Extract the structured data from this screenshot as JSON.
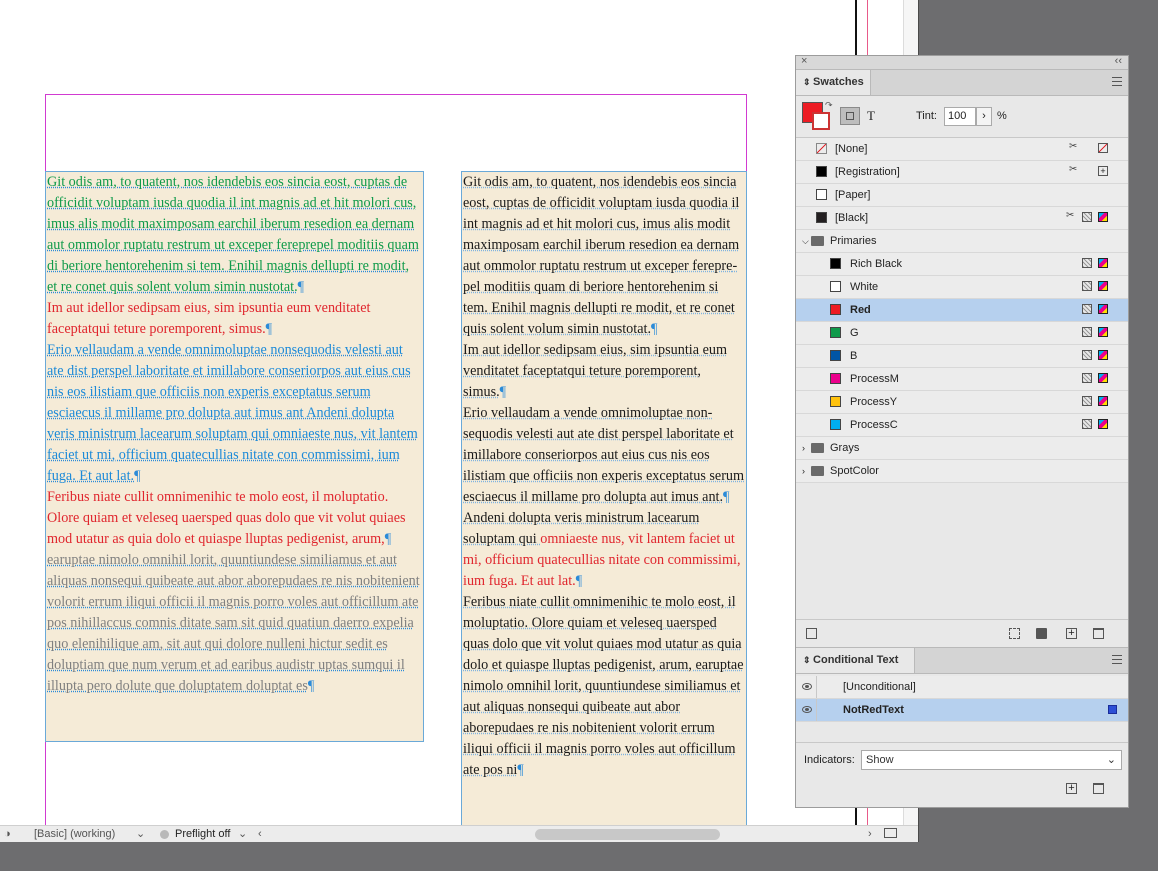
{
  "document": {
    "frame1": [
      {
        "cls": "green",
        "text": "Git odis am, to quatent, nos idendebis eos sincia eost, cup­tas de officidit voluptam iusda quodia il int magnis ad et hit molori cus, imus alis modit maximposam earchil ibe­rum resedion ea dernam aut ommolor ruptatu restrum ut exceper ferepre­pel moditiis quam di beriore hentorehen­im si tem. Enihil magnis dellupti re modit, et re conet quis solent volum simin nustotat."
      },
      {
        "cls": "red",
        "text": "Im aut idellor sedipsam eius, sim ipsuntia eum venditatet faceptatqui teture poremporent, simus."
      },
      {
        "cls": "blue",
        "text": "Erio vellaudam a vende omnimoluptae nonsequodis velesti aut ate dist perspel laboritate et imillabore conseriorpos aut eius cus nis eos ilistiam que officiis non experis excep­tatus serum esciaecus il millame pro dolupta aut imus ant Andeni dolupta veris ministrum lacearum soluptam qui omnia­este nus, vit lantem faciet ut mi, officium quatecul­lias nitate con commissimi, ium fuga. Et aut lat."
      },
      {
        "cls": "red",
        "text": "Feribus niate cullit omnimenihic te molo eost, il molupta­tio. Olore quiam et veleseq uaersped quas dolo que vit volut quiaes mod utatur as quia dolo et quiaspe llupta­s pedigenist, arum,"
      },
      {
        "cls": "gray",
        "text": " earuptae nimolo omnihil lorit, quunti­undese similiamus et aut aliquas nonsequi quibeate aut abor aborepudaes re nis nobitenient volorit errum iliqui officii il magnis porro voles aut officillum ate pos nihil­laccus comnis ditate sam sit quid quatiun daerro expelia quo elenihilique am, sit aut qui dolore nulleni hictur sedit es doluptiam que num verum et ad earibus audistr uptas sumqui il illupta pero dolute que doluptatem doluptat es"
      }
    ],
    "frame2": [
      {
        "cls": "black",
        "text": "Git odis am, to quatent, nos idendebis eos sincia eost, cuptas de officidit voluptam ius­da quodia il int magnis ad et hit molori cus, imus alis modit maximposam earchil iberum resedion ea dernam aut ommolor ruptatu re­strum ut exceper ferepre­pel moditiis quam di beriore hentorehenim si tem. Enihil mag­nis dellupti re modit, et re conet quis solent volum simin nustotat."
      },
      {
        "cls": "black",
        "text": "Im aut idellor sedipsam eius, sim ipsuntia eum venditatet faceptatqui teture porem­porent, simus."
      },
      {
        "cls": "black",
        "text": "Erio vellaudam a vende omnimoluptae non­sequodis velesti aut ate dist perspel labor­itate et imillabore conseriorpos aut eius cus nis eos ilistiam que officiis non experis exceptatus serum esciaecus il millame pro dolupta aut imus ant."
      },
      {
        "cls": "black",
        "text": "Andeni dolupta veris ministrum lacearum soluptam qui ",
        "red": "omniaeste nus, vit lantem fa­ciet ut mi, officium quatecullias nitate con commissimi, ium fuga. Et aut lat."
      },
      {
        "cls": "black",
        "text": "Feribus niate cullit omnimenihic te molo eost, il moluptatio. Olore quiam et veleseq uaersped quas dolo que vit volut quiaes mod utatur as quia dolo et quiaspe lluptas pedigenist, arum, earuptae nimolo omnihil lorit, quuntiundese similiamus et aut aliquas nonsequi quibeate aut abor aborepudaes re nis nobitenient volorit errum iliqui officii il magnis porro voles aut officillum ate pos ni­"
      }
    ]
  },
  "statusbar": {
    "profile": "[Basic] (working)",
    "preflight": "Preflight off"
  },
  "swatches_panel": {
    "tab_label": "Swatches",
    "tint_label": "Tint:",
    "tint_value": "100",
    "percent": "%",
    "text_toggle": "T",
    "fill_color": "#ed1c24",
    "rows": [
      {
        "name": "[None]",
        "chip": "none",
        "icons": [
          "scissor",
          "none-box"
        ],
        "indent": 0
      },
      {
        "name": "[Registration]",
        "chip": "#000000",
        "icons": [
          "scissor",
          "reg"
        ],
        "indent": 0
      },
      {
        "name": "[Paper]",
        "chip": "#ffffff",
        "icons": [],
        "indent": 0
      },
      {
        "name": "[Black]",
        "chip": "#231f20",
        "icons": [
          "scissor",
          "tint",
          "cmyk"
        ],
        "indent": 0
      },
      {
        "name": "Primaries",
        "chip": "folder",
        "icons": [],
        "indent": 0,
        "group": true,
        "open": true
      },
      {
        "name": "Rich Black",
        "chip": "#000000",
        "icons": [
          "tint",
          "cmyk"
        ],
        "indent": 1
      },
      {
        "name": "White",
        "chip": "#ffffff",
        "icons": [
          "tint",
          "cmyk"
        ],
        "indent": 1
      },
      {
        "name": "Red",
        "chip": "#ed1c24",
        "icons": [
          "tint",
          "cmyk"
        ],
        "indent": 1,
        "selected": true
      },
      {
        "name": "G",
        "chip": "#0f9a4a",
        "icons": [
          "tint",
          "cmyk"
        ],
        "indent": 1
      },
      {
        "name": "B",
        "chip": "#0055a5",
        "icons": [
          "tint",
          "cmyk"
        ],
        "indent": 1
      },
      {
        "name": "ProcessM",
        "chip": "#ec008c",
        "icons": [
          "tint",
          "cmyk"
        ],
        "indent": 1
      },
      {
        "name": "ProcessY",
        "chip": "#ffc20e",
        "icons": [
          "tint",
          "cmyk"
        ],
        "indent": 1
      },
      {
        "name": "ProcessC",
        "chip": "#00aeef",
        "icons": [
          "tint",
          "cmyk"
        ],
        "indent": 1
      },
      {
        "name": "Grays",
        "chip": "folder",
        "icons": [],
        "indent": 0,
        "group": true,
        "open": false
      },
      {
        "name": "SpotColor",
        "chip": "folder",
        "icons": [],
        "indent": 0,
        "group": true,
        "open": false
      }
    ]
  },
  "conditional_text_panel": {
    "tab_label": "Conditional Text",
    "rows": [
      {
        "name": "[Unconditional]",
        "selected": false,
        "swatch": null
      },
      {
        "name": "NotRedText",
        "selected": true,
        "swatch": "#2d4fd6"
      }
    ],
    "indicators_label": "Indicators:",
    "indicators_value": "Show"
  }
}
